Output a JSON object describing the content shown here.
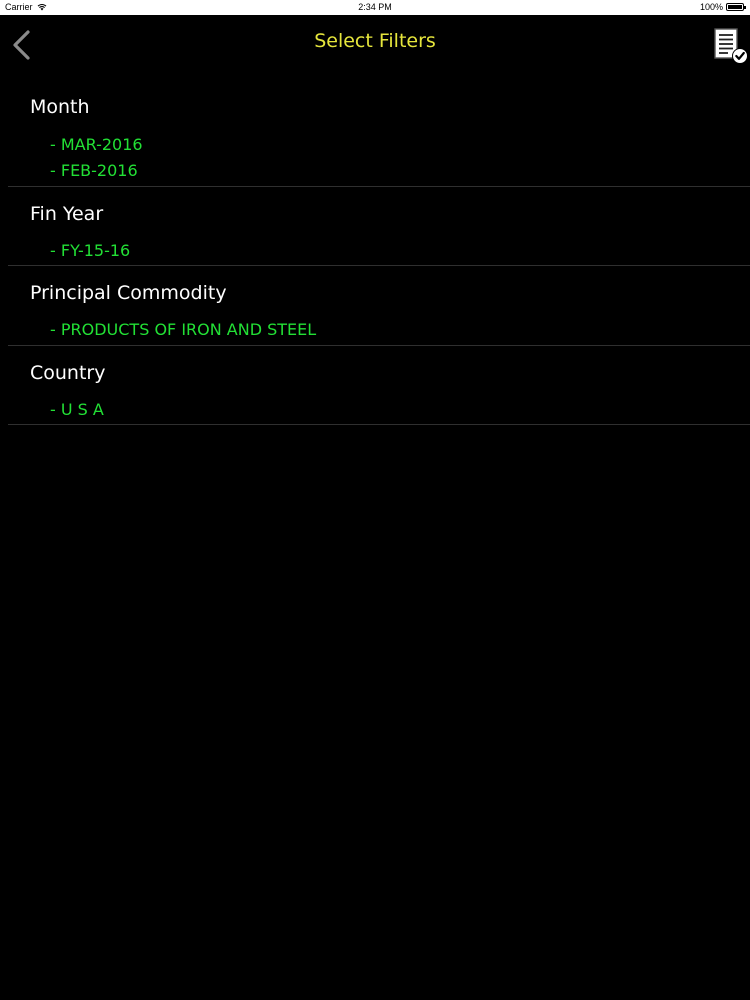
{
  "status_bar": {
    "carrier": "Carrier",
    "time": "2:34 PM",
    "battery": "100%",
    "battery_level": 1.0
  },
  "nav": {
    "back_icon": "chevron-left-icon",
    "title": "Select Filters",
    "apply_icon": "document-check-icon"
  },
  "colors": {
    "background": "#000000",
    "title": "#e6e63c",
    "section_label": "#ffffff",
    "value": "#22e035",
    "divider": "#2f2f2f"
  },
  "filters": [
    {
      "label": "Month",
      "values": [
        "- MAR-2016",
        "- FEB-2016"
      ]
    },
    {
      "label": "Fin Year",
      "values": [
        "- FY-15-16"
      ]
    },
    {
      "label": "Principal Commodity",
      "values": [
        "- PRODUCTS OF IRON AND STEEL"
      ]
    },
    {
      "label": "Country",
      "values": [
        "- U S A"
      ]
    }
  ]
}
